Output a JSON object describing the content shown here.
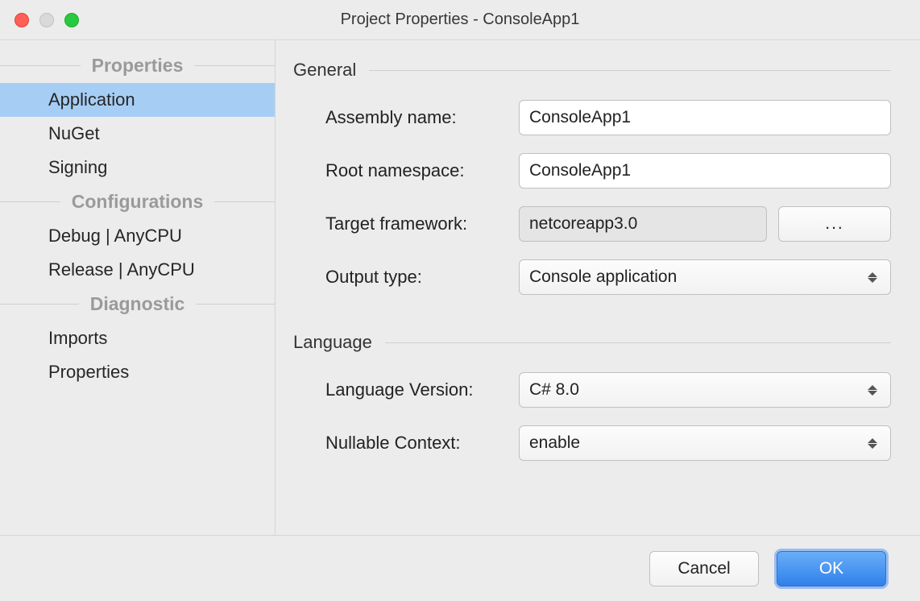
{
  "window": {
    "title": "Project Properties - ConsoleApp1"
  },
  "sidebar": {
    "sections": [
      {
        "title": "Properties",
        "items": [
          {
            "label": "Application",
            "selected": true
          },
          {
            "label": "NuGet",
            "selected": false
          },
          {
            "label": "Signing",
            "selected": false
          }
        ]
      },
      {
        "title": "Configurations",
        "items": [
          {
            "label": "Debug | AnyCPU",
            "selected": false
          },
          {
            "label": "Release | AnyCPU",
            "selected": false
          }
        ]
      },
      {
        "title": "Diagnostic",
        "items": [
          {
            "label": "Imports",
            "selected": false
          },
          {
            "label": "Properties",
            "selected": false
          }
        ]
      }
    ]
  },
  "main": {
    "groups": {
      "general": {
        "title": "General",
        "assembly_name_label": "Assembly name:",
        "assembly_name_value": "ConsoleApp1",
        "root_namespace_label": "Root namespace:",
        "root_namespace_value": "ConsoleApp1",
        "target_framework_label": "Target framework:",
        "target_framework_value": "netcoreapp3.0",
        "target_framework_browse": "...",
        "output_type_label": "Output type:",
        "output_type_value": "Console application"
      },
      "language": {
        "title": "Language",
        "language_version_label": "Language Version:",
        "language_version_value": "C# 8.0",
        "nullable_context_label": "Nullable Context:",
        "nullable_context_value": "enable"
      }
    }
  },
  "footer": {
    "cancel": "Cancel",
    "ok": "OK"
  }
}
